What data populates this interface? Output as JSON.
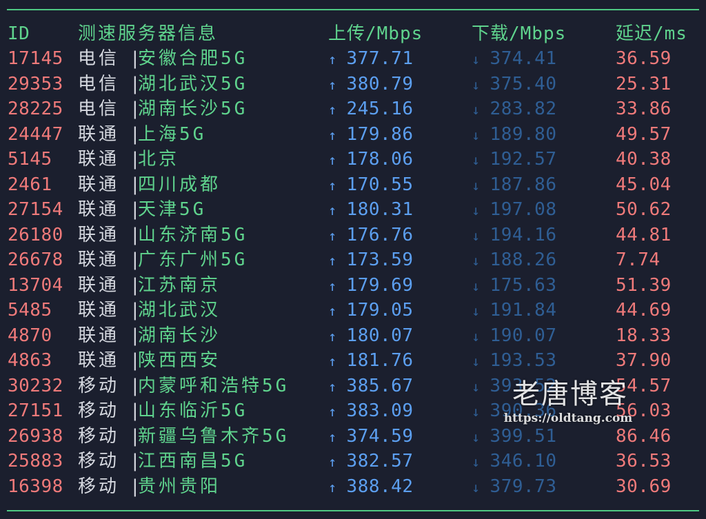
{
  "header": {
    "id": "ID",
    "node": "测速服务器信息",
    "upload": "上传/Mbps",
    "download": "下载/Mbps",
    "latency": "延迟/ms"
  },
  "separator": "|",
  "arrows": {
    "up": "↑",
    "down": "↓"
  },
  "rows": [
    {
      "id": "17145",
      "isp": "电信",
      "location": "安徽合肥5G",
      "up": "377.71",
      "down": "374.41",
      "latency": "36.59"
    },
    {
      "id": "29353",
      "isp": "电信",
      "location": "湖北武汉5G",
      "up": "380.79",
      "down": "375.40",
      "latency": "25.31"
    },
    {
      "id": "28225",
      "isp": "电信",
      "location": "湖南长沙5G",
      "up": "245.16",
      "down": "283.82",
      "latency": "33.86"
    },
    {
      "id": "24447",
      "isp": "联通",
      "location": "上海5G",
      "up": "179.86",
      "down": "189.80",
      "latency": "49.57"
    },
    {
      "id": "5145",
      "isp": "联通",
      "location": "北京",
      "up": "178.06",
      "down": "192.57",
      "latency": "40.38"
    },
    {
      "id": "2461",
      "isp": "联通",
      "location": "四川成都",
      "up": "170.55",
      "down": "187.86",
      "latency": "45.04"
    },
    {
      "id": "27154",
      "isp": "联通",
      "location": "天津5G",
      "up": "180.31",
      "down": "197.08",
      "latency": "50.62"
    },
    {
      "id": "26180",
      "isp": "联通",
      "location": "山东济南5G",
      "up": "176.76",
      "down": "194.16",
      "latency": "44.81"
    },
    {
      "id": "26678",
      "isp": "联通",
      "location": "广东广州5G",
      "up": "173.59",
      "down": "188.26",
      "latency": "7.74"
    },
    {
      "id": "13704",
      "isp": "联通",
      "location": "江苏南京",
      "up": "179.69",
      "down": "175.63",
      "latency": "51.39"
    },
    {
      "id": "5485",
      "isp": "联通",
      "location": "湖北武汉",
      "up": "179.05",
      "down": "191.84",
      "latency": "44.69"
    },
    {
      "id": "4870",
      "isp": "联通",
      "location": "湖南长沙",
      "up": "180.07",
      "down": "190.07",
      "latency": "18.33"
    },
    {
      "id": "4863",
      "isp": "联通",
      "location": "陕西西安",
      "up": "181.76",
      "down": "193.53",
      "latency": "37.90"
    },
    {
      "id": "30232",
      "isp": "移动",
      "location": "内蒙呼和浩特5G",
      "up": "385.67",
      "down": "393.52",
      "latency": "54.57"
    },
    {
      "id": "27151",
      "isp": "移动",
      "location": "山东临沂5G",
      "up": "383.09",
      "down": "390.36",
      "latency": "56.03"
    },
    {
      "id": "26938",
      "isp": "移动",
      "location": "新疆乌鲁木齐5G",
      "up": "374.59",
      "down": "399.51",
      "latency": "86.46"
    },
    {
      "id": "25883",
      "isp": "移动",
      "location": "江西南昌5G",
      "up": "382.57",
      "down": "346.10",
      "latency": "36.53"
    },
    {
      "id": "16398",
      "isp": "移动",
      "location": "贵州贵阳",
      "up": "388.42",
      "down": "379.73",
      "latency": "30.69"
    }
  ],
  "watermark": {
    "title": "老唐博客",
    "url": "https://oldtang.com"
  },
  "colors": {
    "background": "#1b1f2e",
    "header": "#5fd38d",
    "id": "#ef7a7a",
    "location": "#5fd38d",
    "upload": "#5c9ff0",
    "download": "#2f5e94",
    "latency": "#ef7a7a"
  }
}
